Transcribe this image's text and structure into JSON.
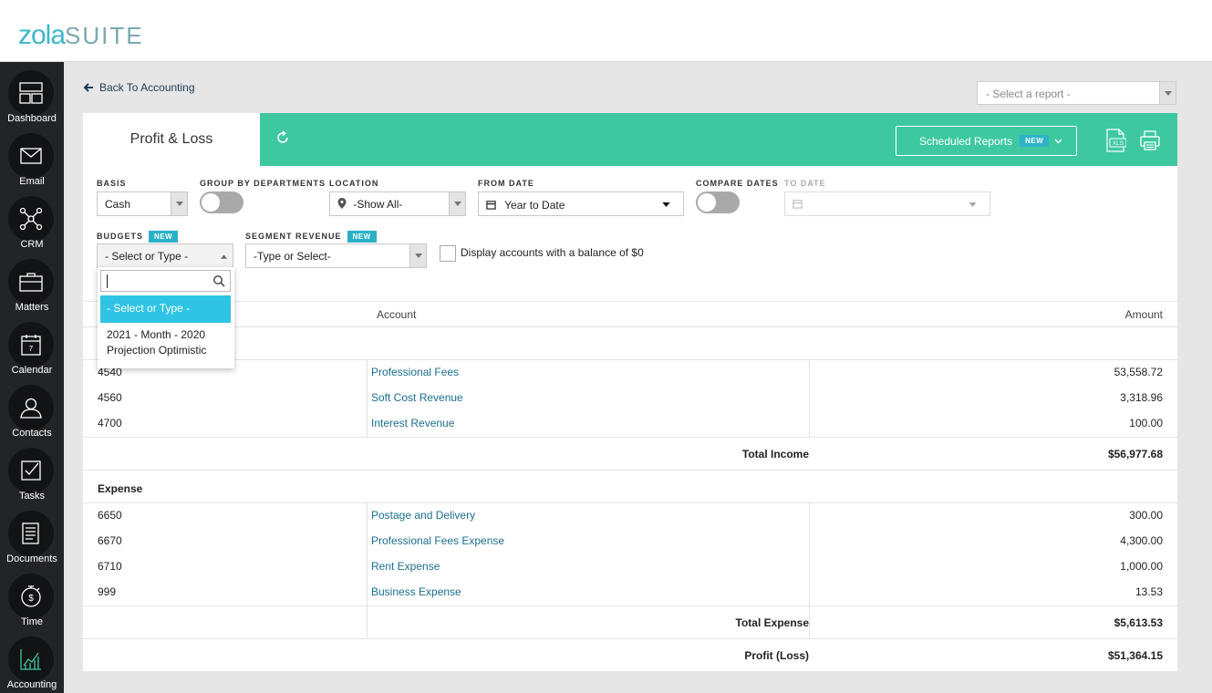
{
  "app": {
    "logo_primary": "zola",
    "logo_secondary": "SUITE"
  },
  "sidebar": {
    "items": [
      {
        "label": "Dashboard",
        "icon": "dashboard-icon"
      },
      {
        "label": "Email",
        "icon": "envelope-icon"
      },
      {
        "label": "CRM",
        "icon": "network-icon"
      },
      {
        "label": "Matters",
        "icon": "briefcase-icon"
      },
      {
        "label": "Calendar",
        "icon": "calendar-icon"
      },
      {
        "label": "Contacts",
        "icon": "person-icon"
      },
      {
        "label": "Tasks",
        "icon": "checkbox-icon"
      },
      {
        "label": "Documents",
        "icon": "document-icon"
      },
      {
        "label": "Time",
        "icon": "stopwatch-icon"
      },
      {
        "label": "Accounting",
        "icon": "chart-icon"
      }
    ],
    "active": "Accounting",
    "calendar_day": "7"
  },
  "nav": {
    "back_label": "Back To Accounting",
    "report_placeholder": "- Select a report -"
  },
  "report": {
    "title": "Profit & Loss",
    "scheduled_label": "Scheduled Reports",
    "new_badge": "NEW",
    "xls_label": "XLS"
  },
  "filters": {
    "basis_label": "BASIS",
    "basis_value": "Cash",
    "group_by_label": "GROUP BY DEPARTMENTS",
    "group_by_on": false,
    "location_label": "LOCATION",
    "location_value": "-Show All-",
    "from_date_label": "FROM DATE",
    "from_date_value": "Year to Date",
    "compare_label": "COMPARE DATES",
    "compare_on": false,
    "to_date_label": "TO DATE",
    "budgets_label": "BUDGETS",
    "budgets_value": "- Select or Type -",
    "segment_label": "SEGMENT REVENUE",
    "segment_value": "-Type or Select-",
    "zero_balance_label": "Display accounts with a balance of $0",
    "zero_balance_checked": false
  },
  "budgets_dropdown": {
    "search_value": "",
    "options": [
      "- Select or Type -",
      "2021 - Month - 2020 Projection Optimistic"
    ],
    "selected_index": 0
  },
  "table": {
    "col_account": "Account",
    "col_amount": "Amount",
    "income_rows": [
      {
        "code": "4540",
        "account": "Professional Fees",
        "amount": "53,558.72"
      },
      {
        "code": "4560",
        "account": "Soft Cost Revenue",
        "amount": "3,318.96"
      },
      {
        "code": "4700",
        "account": "Interest Revenue",
        "amount": "100.00"
      }
    ],
    "total_income_label": "Total Income",
    "total_income": "$56,977.68",
    "expense_header": "Expense",
    "expense_rows": [
      {
        "code": "6650",
        "account": "Postage and Delivery",
        "amount": "300.00"
      },
      {
        "code": "6670",
        "account": "Professional Fees Expense",
        "amount": "4,300.00"
      },
      {
        "code": "6710",
        "account": "Rent Expense",
        "amount": "1,000.00"
      },
      {
        "code": "999",
        "account": "Business Expense",
        "amount": "13.53"
      }
    ],
    "total_expense_label": "Total Expense",
    "total_expense": "$5,613.53",
    "profit_label": "Profit (Loss)",
    "profit": "$51,364.15"
  },
  "colors": {
    "accent": "#3dc8a0",
    "sidebar": "#222426",
    "link": "#1a6e8e",
    "dropdown_highlight": "#2fc4e4"
  }
}
